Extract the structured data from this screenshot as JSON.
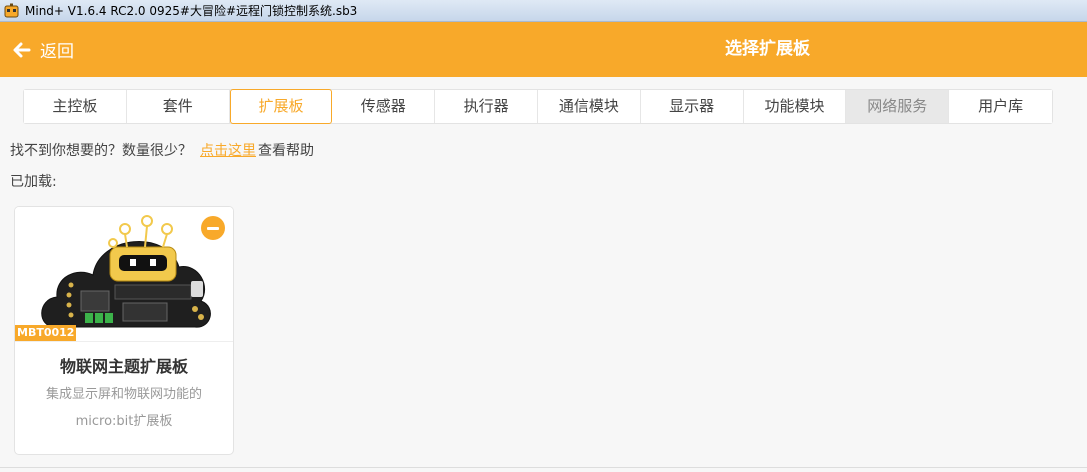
{
  "window": {
    "title": "Mind+ V1.6.4 RC2.0   0925#大冒险#远程门锁控制系统.sb3"
  },
  "header": {
    "back_label": "返回",
    "title": "选择扩展板"
  },
  "tabs": [
    {
      "label": "主控板"
    },
    {
      "label": "套件"
    },
    {
      "label": "扩展板"
    },
    {
      "label": "传感器"
    },
    {
      "label": "执行器"
    },
    {
      "label": "通信模块"
    },
    {
      "label": "显示器"
    },
    {
      "label": "功能模块"
    },
    {
      "label": "网络服务"
    },
    {
      "label": "用户库"
    }
  ],
  "active_tab": "扩展板",
  "help": {
    "prefix": "找不到你想要的？数量很少？",
    "link": "点击这里",
    "suffix": "查看帮助"
  },
  "loaded_label": "已加载:",
  "cards": [
    {
      "id": "MBT0012",
      "title": "物联网主题扩展板",
      "desc_line1": "集成显示屏和物联网功能的",
      "desc_line2": "micro:bit扩展板"
    }
  ],
  "colors": {
    "accent": "#f8a92a",
    "header_bg": "#f8a92a",
    "page_bg": "#f7f7f7"
  }
}
